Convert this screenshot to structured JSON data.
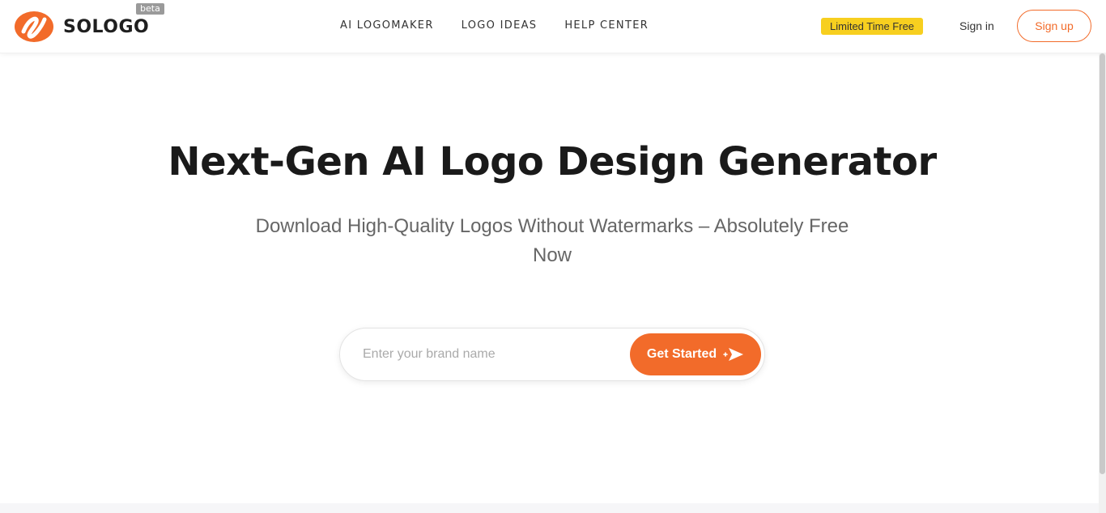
{
  "brand": {
    "name": "SOLOGO",
    "badge": "beta",
    "accent_color": "#f26b2a",
    "logo_icon": "sologo-mark-icon"
  },
  "nav": {
    "items": [
      {
        "label": "AI LOGOMAKER"
      },
      {
        "label": "LOGO IDEAS"
      },
      {
        "label": "HELP CENTER"
      }
    ]
  },
  "header_right": {
    "promo_label": "Limited Time Free",
    "promo_color": "#f7cf1f",
    "signin_label": "Sign in",
    "signup_label": "Sign up"
  },
  "hero": {
    "title": "Next-Gen AI Logo Design Generator",
    "subtitle": "Download High-Quality Logos Without Watermarks – Absolutely Free Now"
  },
  "search": {
    "placeholder": "Enter your brand name",
    "value": "",
    "button_label": "Get Started",
    "button_icon": "send-arrow-icon"
  }
}
